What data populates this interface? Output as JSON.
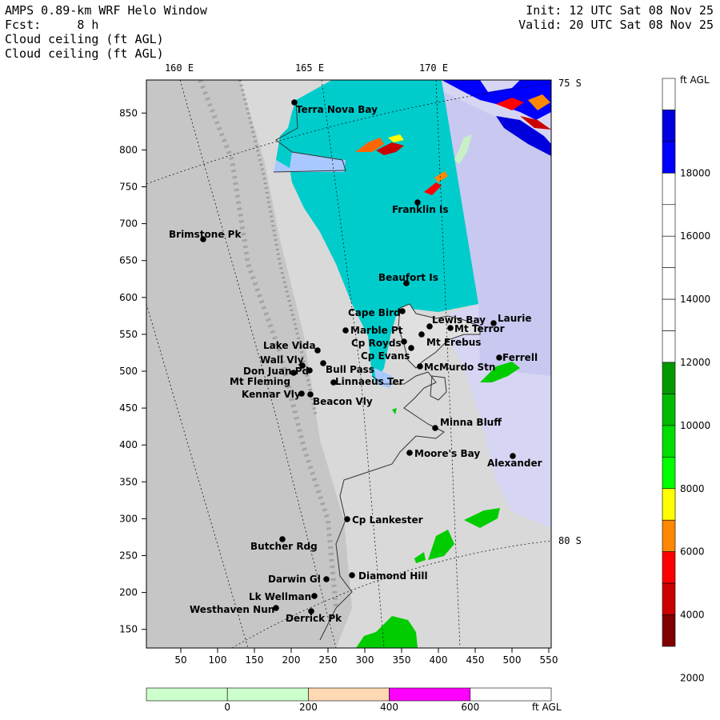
{
  "header": {
    "title": "AMPS 0.89-km WRF Helo Window",
    "forecast_label": "Fcst:",
    "forecast_value": "8 h",
    "field_line_1": "Cloud ceiling (ft AGL)",
    "field_line_2": "Cloud ceiling (ft AGL)",
    "init": "Init: 12 UTC Sat 08 Nov 25",
    "valid": "Valid: 20 UTC Sat 08 Nov 25"
  },
  "map": {
    "longitude_labels": [
      "160 E",
      "165 E",
      "170 E"
    ],
    "latitude_labels": [
      "75 S",
      "80 S"
    ],
    "x_ticks": [
      "50",
      "100",
      "150",
      "200",
      "250",
      "300",
      "350",
      "400",
      "450",
      "500",
      "550"
    ],
    "y_ticks": [
      "150",
      "200",
      "250",
      "300",
      "350",
      "400",
      "450",
      "500",
      "550",
      "600",
      "650",
      "700",
      "750",
      "800",
      "850"
    ],
    "stations": [
      {
        "name": "Terra Nova Bay"
      },
      {
        "name": "Franklin Is"
      },
      {
        "name": "Brimstone Pk"
      },
      {
        "name": "Beaufort Is"
      },
      {
        "name": "Cape Bird"
      },
      {
        "name": "Lewis Bay"
      },
      {
        "name": "Laurie"
      },
      {
        "name": "Mt Terror"
      },
      {
        "name": "Marble Pt"
      },
      {
        "name": "Cp Royds"
      },
      {
        "name": "Mt Erebus"
      },
      {
        "name": "Cp Evans"
      },
      {
        "name": "Lake Vida"
      },
      {
        "name": "Ferrell"
      },
      {
        "name": "Wall Vly"
      },
      {
        "name": "Bull Pass"
      },
      {
        "name": "McMurdo Stn"
      },
      {
        "name": "Don Juan Pd"
      },
      {
        "name": "Mt Fleming"
      },
      {
        "name": "Linnaeus Ter"
      },
      {
        "name": "Kennar Vly"
      },
      {
        "name": "Beacon Vly"
      },
      {
        "name": "Minna Bluff"
      },
      {
        "name": "Moore's Bay"
      },
      {
        "name": "Alexander"
      },
      {
        "name": "Cp Lankester"
      },
      {
        "name": "Butcher Rdg"
      },
      {
        "name": "Diamond Hill"
      },
      {
        "name": "Darwin Gl"
      },
      {
        "name": "Lk Wellman"
      },
      {
        "name": "Westhaven Nun"
      },
      {
        "name": "Derrick Pk"
      }
    ]
  },
  "colorbar_right": {
    "unit": "ft AGL",
    "labels": [
      "18000",
      "16000",
      "14000",
      "12000",
      "10000",
      "8000",
      "6000",
      "4000",
      "2000"
    ],
    "colors": [
      "#ffffff",
      "#0000dd",
      "#0000ff",
      "#ffffff",
      "#ffffff",
      "#ffffff",
      "#ffffff",
      "#ffffff",
      "#ffffff",
      "#009900",
      "#00bb00",
      "#00dd00",
      "#00ff00",
      "#ffff00",
      "#ff8800",
      "#ff0000",
      "#cc0000",
      "#800000"
    ]
  },
  "colorbar_bottom": {
    "unit": "ft AGL",
    "labels": [
      "0",
      "200",
      "400",
      "600"
    ],
    "colors": [
      "#ccffcc",
      "#ccffcc",
      "#ffd9b3",
      "#ff00ff",
      "#ffffff"
    ]
  }
}
